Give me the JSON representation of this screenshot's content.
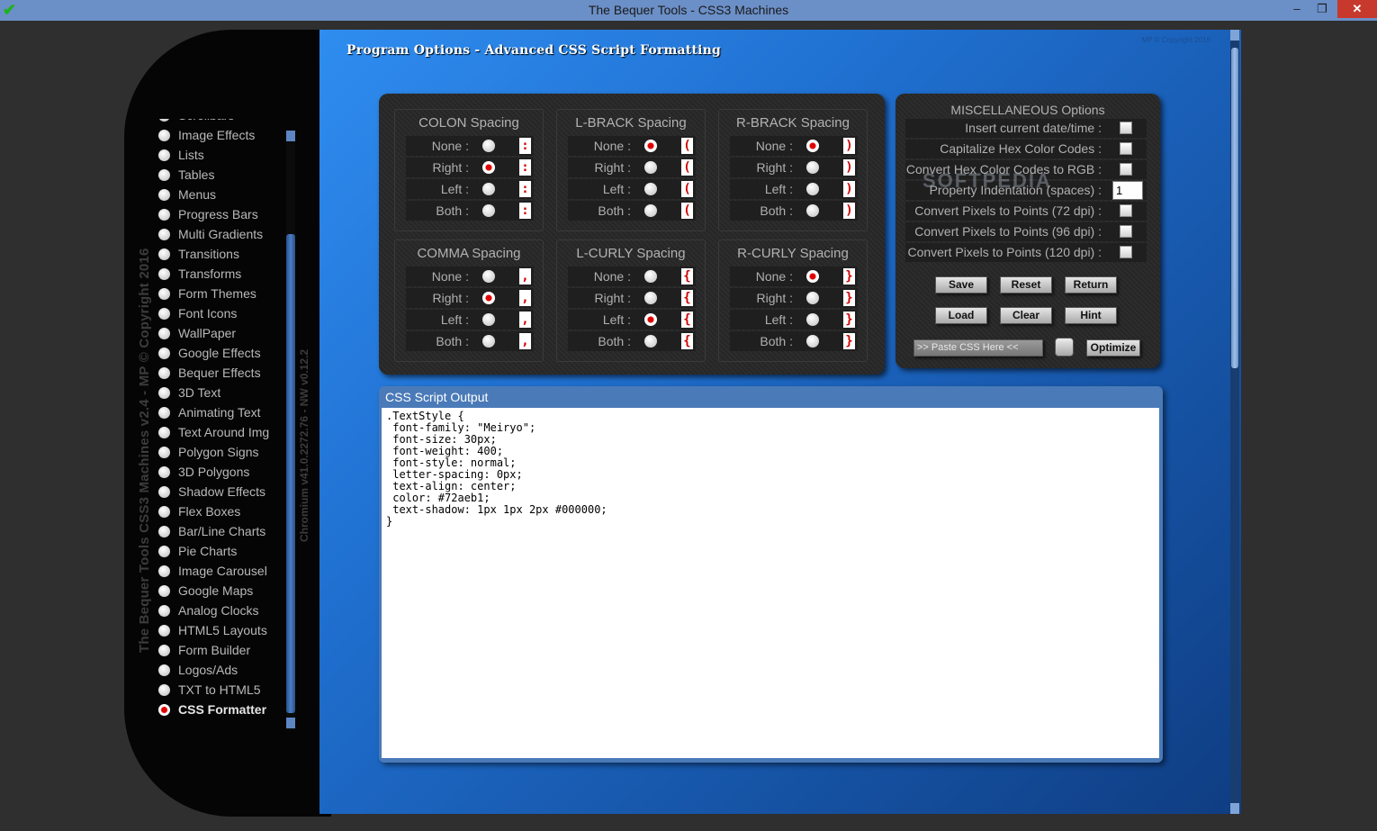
{
  "window": {
    "title": "The Bequer Tools - CSS3 Machines",
    "minimize_glyph": "–",
    "restore_glyph": "❐",
    "close_glyph": "✕",
    "app_icon_glyph": "✔"
  },
  "sidebar": {
    "vertical_caption": "The Bequer Tools CSS3 Machines v2.4 - MP © Copyright 2016",
    "vertical_version": "Chromium v41.0.2272.76 - NW v0.12.2",
    "partial_item": "Scrollbars",
    "items": [
      "Image Effects",
      "Lists",
      "Tables",
      "Menus",
      "Progress Bars",
      "Multi Gradients",
      "Transitions",
      "Transforms",
      "Form Themes",
      "Font Icons",
      "WallPaper",
      "Google Effects",
      "Bequer Effects",
      "3D Text",
      "Animating Text",
      "Text Around Img",
      "Polygon Signs",
      "3D Polygons",
      "Shadow Effects",
      "Flex Boxes",
      "Bar/Line Charts",
      "Pie Charts",
      "Image Carousel",
      "Google Maps",
      "Analog Clocks",
      "HTML5 Layouts",
      "Form Builder",
      "Logos/Ads",
      "TXT to HTML5",
      "CSS Formatter"
    ],
    "active_item": "CSS Formatter"
  },
  "main": {
    "page_title": "Program Options - Advanced CSS Script Formatting",
    "copyright": "MP © Copyright 2016"
  },
  "spacing": {
    "row_labels": [
      "None :",
      "Right :",
      "Left :",
      "Both :"
    ],
    "groups": [
      {
        "title": "COLON Spacing",
        "selected": 1,
        "previews": [
          ":",
          ":",
          ":",
          ":"
        ]
      },
      {
        "title": "L-BRACK Spacing",
        "selected": 0,
        "previews": [
          "(",
          "(",
          "(",
          "("
        ]
      },
      {
        "title": "R-BRACK Spacing",
        "selected": 0,
        "previews": [
          ")",
          ")",
          ")",
          ")"
        ]
      },
      {
        "title": "COMMA Spacing",
        "selected": 1,
        "previews": [
          ",",
          ",",
          ",",
          ","
        ]
      },
      {
        "title": "L-CURLY Spacing",
        "selected": 2,
        "previews": [
          "{",
          "{",
          "{",
          "{"
        ]
      },
      {
        "title": "R-CURLY Spacing",
        "selected": 0,
        "previews": [
          "}",
          "}",
          "}",
          "}"
        ]
      }
    ]
  },
  "misc": {
    "title": "MISCELLANEOUS Options",
    "options": [
      {
        "label": "Insert current date/time :",
        "type": "checkbox",
        "checked": false
      },
      {
        "label": "Capitalize Hex Color Codes :",
        "type": "checkbox",
        "checked": false
      },
      {
        "label": "Convert Hex Color Codes to RGB :",
        "type": "checkbox",
        "checked": false
      },
      {
        "label": "Property Indentation (spaces) :",
        "type": "number",
        "value": "1"
      },
      {
        "label": "Convert Pixels to Points (72 dpi) :",
        "type": "checkbox",
        "checked": false
      },
      {
        "label": "Convert Pixels to Points (96 dpi) :",
        "type": "checkbox",
        "checked": false
      },
      {
        "label": "Convert Pixels to Points (120 dpi) :",
        "type": "checkbox",
        "checked": false
      }
    ],
    "buttons": {
      "save": "Save",
      "reset": "Reset",
      "return": "Return",
      "load": "Load",
      "clear": "Clear",
      "hint": "Hint",
      "optimize": "Optimize"
    },
    "paste_placeholder": ">> Paste CSS Here <<"
  },
  "output": {
    "title": "CSS Script Output",
    "code": ".TextStyle {\n font-family: \"Meiryo\";\n font-size: 30px;\n font-weight: 400;\n font-style: normal;\n letter-spacing: 0px;\n text-align: center;\n color: #72aeb1;\n text-shadow: 1px 1px 2px #000000;\n}"
  },
  "watermark": "SOFTPEDIA"
}
